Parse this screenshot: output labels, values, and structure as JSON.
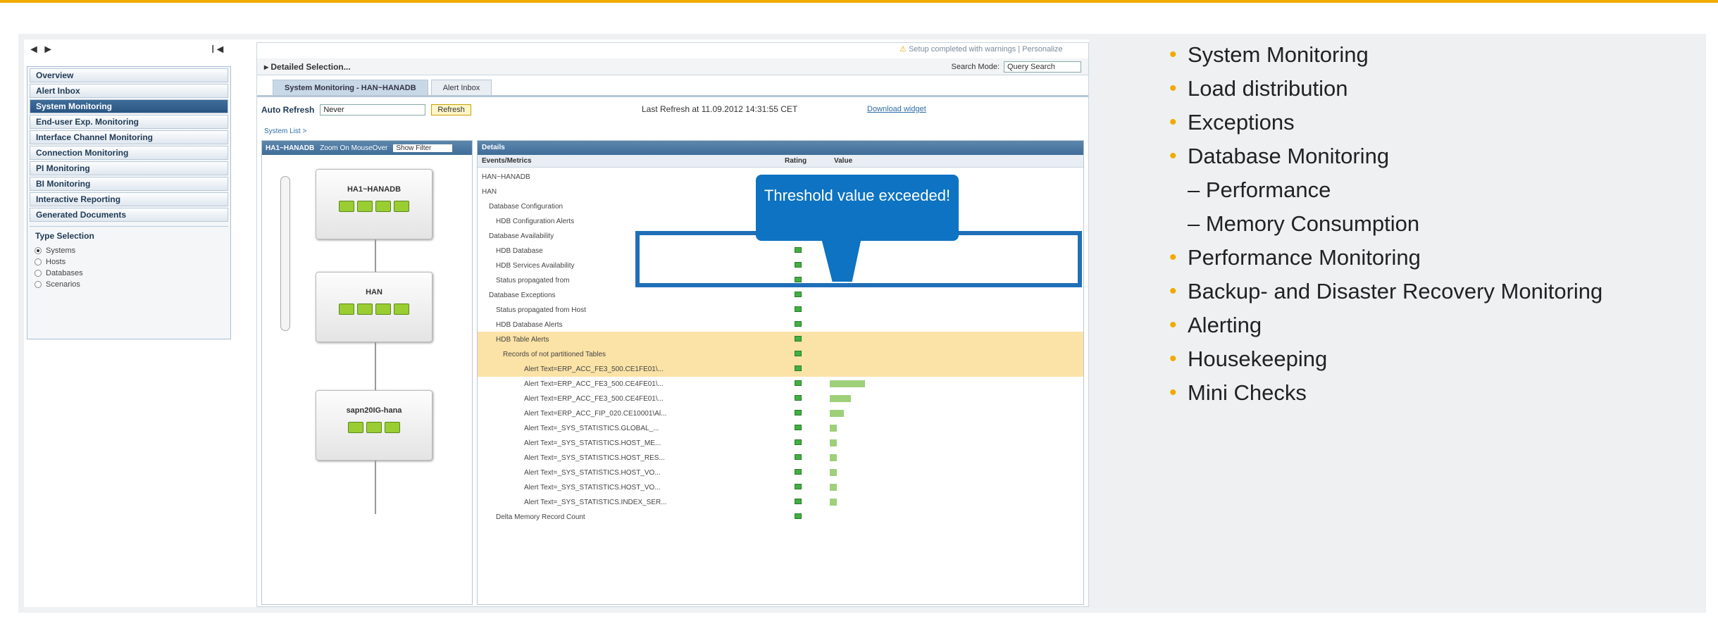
{
  "nav": {
    "arrows": "◄ ►",
    "collapse": "I◄",
    "items": [
      "Overview",
      "Alert Inbox",
      "System Monitoring",
      "End-user Exp. Monitoring",
      "Interface Channel Monitoring",
      "Connection Monitoring",
      "PI Monitoring",
      "BI Monitoring",
      "Interactive Reporting",
      "Generated Documents"
    ],
    "type_selection": "Type Selection",
    "options": [
      "Systems",
      "Hosts",
      "Databases",
      "Scenarios"
    ]
  },
  "header": {
    "setup": "Setup completed with warnings",
    "personalize": "Personalize",
    "detailed": "▸ Detailed Selection...",
    "search_mode_label": "Search Mode:",
    "search_mode": "Query Search"
  },
  "tabs": [
    "System Monitoring - HAN~HANADB",
    "Alert Inbox"
  ],
  "toolbar": {
    "auto_refresh": "Auto Refresh",
    "refresh_value": "Never",
    "refresh_btn": "Refresh",
    "last_refresh": "Last Refresh at  11.09.2012 14:31:55 CET",
    "download": "Download widget"
  },
  "crumb": "System List  >",
  "pane": {
    "title": "HA1~HANADB",
    "zoom": "Zoom On MouseOver",
    "filter": "Show Filter"
  },
  "nodes": [
    "HA1~HANADB",
    "HAN",
    "sapn20IG-hana"
  ],
  "details": {
    "title": "Details",
    "col_events": "Events/Metrics",
    "col_rating": "Rating",
    "col_value": "Value",
    "rows": [
      "HAN~HANADB",
      "HAN",
      "Database Configuration",
      "HDB Configuration Alerts",
      "Database Availability",
      "HDB Database",
      "HDB Services Availability",
      "Status propagated from",
      "Database Exceptions",
      "Status propagated from Host",
      "HDB Database Alerts",
      "HDB Table Alerts",
      "Records of not partitioned Tables",
      "Alert Text=ERP_ACC_FE3_500.CE1FE01\\...",
      "Alert Text=ERP_ACC_FE3_500.CE4FE01\\...",
      "Alert Text=ERP_ACC_FE3_500.CE4FE01\\...",
      "Alert Text=ERP_ACC_FIP_020.CE10001\\Al...",
      "Alert Text=_SYS_STATISTICS.GLOBAL_...",
      "Alert Text=_SYS_STATISTICS.HOST_ME...",
      "Alert Text=_SYS_STATISTICS.HOST_RES...",
      "Alert Text=_SYS_STATISTICS.HOST_VO...",
      "Alert Text=_SYS_STATISTICS.HOST_VO...",
      "Alert Text=_SYS_STATISTICS.INDEX_SER...",
      "Delta Memory Record Count"
    ]
  },
  "callout": "Threshold value exceeded!",
  "bullets": [
    {
      "text": "System Monitoring",
      "sub": false
    },
    {
      "text": "Load distribution",
      "sub": false
    },
    {
      "text": "Exceptions",
      "sub": false
    },
    {
      "text": "Database Monitoring",
      "sub": false
    },
    {
      "text": "– Performance",
      "sub": true
    },
    {
      "text": "– Memory Consumption",
      "sub": true
    },
    {
      "text": "Performance Monitoring",
      "sub": false
    },
    {
      "text": "Backup- and Disaster Recovery Monitoring",
      "sub": false
    },
    {
      "text": "Alerting",
      "sub": false
    },
    {
      "text": "Housekeeping",
      "sub": false
    },
    {
      "text": "Mini Checks",
      "sub": false
    }
  ],
  "colors": {
    "accent": "#f0ab00",
    "callout": "#0d73c2",
    "frame": "#1f6fb8"
  }
}
